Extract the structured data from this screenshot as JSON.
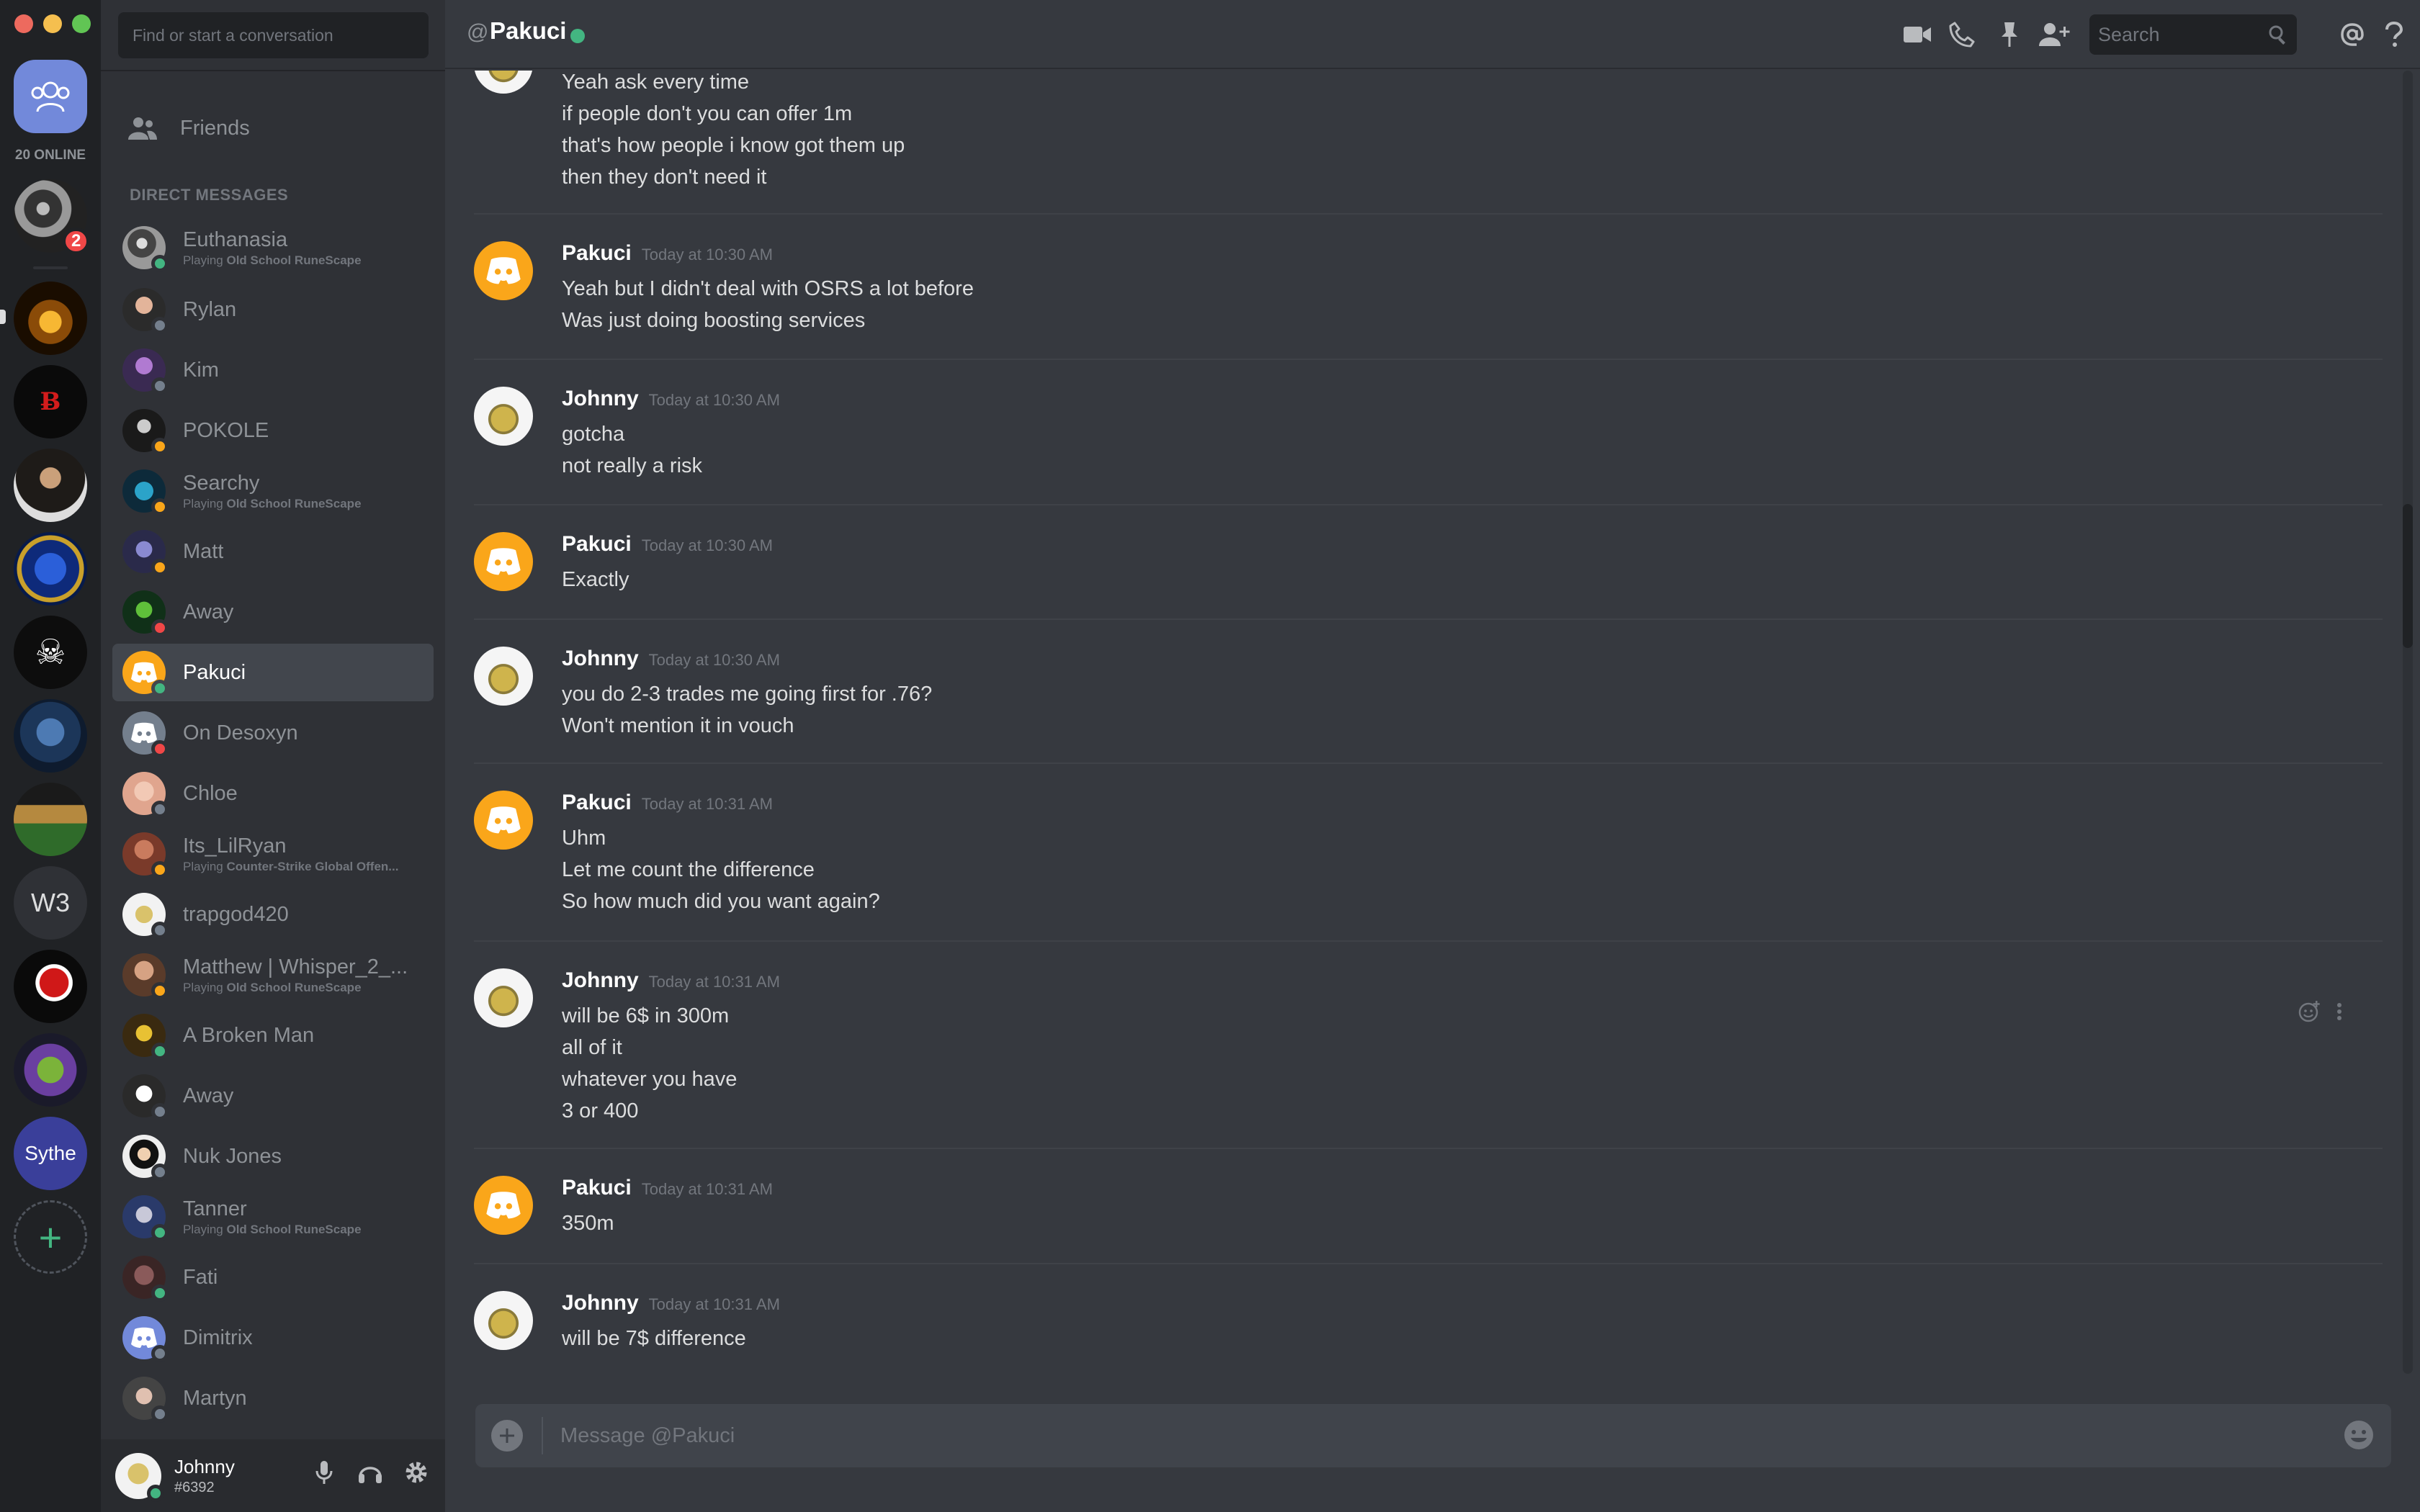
{
  "window": {
    "controls": [
      "close",
      "minimize",
      "maximize"
    ]
  },
  "servers": {
    "online_label": "20 ONLINE",
    "badge_count": "2",
    "w3_label": "W3",
    "add_label": "+"
  },
  "dm_sidebar": {
    "search_placeholder": "Find or start a conversation",
    "friends_label": "Friends",
    "section_header": "DIRECT MESSAGES",
    "items": [
      {
        "name": "Euthanasia",
        "status": "online",
        "activity_prefix": "Playing ",
        "activity_game": "Old School RuneScape"
      },
      {
        "name": "Rylan",
        "status": "offline"
      },
      {
        "name": "Kim",
        "status": "offline"
      },
      {
        "name": "POKOLE",
        "status": "idle"
      },
      {
        "name": "Searchy",
        "status": "idle",
        "activity_prefix": "Playing ",
        "activity_game": "Old School RuneScape"
      },
      {
        "name": "Matt",
        "status": "idle"
      },
      {
        "name": "Away",
        "status": "dnd"
      },
      {
        "name": "Pakuci",
        "status": "online",
        "active": true
      },
      {
        "name": "On Desoxyn",
        "status": "dnd"
      },
      {
        "name": "Chloe",
        "status": "offline"
      },
      {
        "name": "Its_LilRyan",
        "status": "idle",
        "activity_prefix": "Playing ",
        "activity_game": "Counter-Strike Global Offen..."
      },
      {
        "name": "trapgod420",
        "status": "offline"
      },
      {
        "name": "Matthew | Whisper_2_...",
        "status": "idle",
        "activity_prefix": "Playing ",
        "activity_game": "Old School RuneScape"
      },
      {
        "name": "A Broken Man",
        "status": "online"
      },
      {
        "name": "Away",
        "status": "offline"
      },
      {
        "name": "Nuk Jones",
        "status": "offline"
      },
      {
        "name": "Tanner",
        "status": "online",
        "activity_prefix": "Playing ",
        "activity_game": "Old School RuneScape"
      },
      {
        "name": "Fati",
        "status": "online"
      },
      {
        "name": "Dimitrix",
        "status": "offline"
      },
      {
        "name": "Martyn",
        "status": "offline"
      }
    ]
  },
  "user_panel": {
    "name": "Johnny",
    "tag": "#6392"
  },
  "topbar": {
    "at_symbol": "@",
    "channel_name": "Pakuci",
    "search_placeholder": "Search",
    "icons": [
      "video-call-icon",
      "voice-call-icon",
      "pin-icon",
      "add-friend-icon",
      "search-icon",
      "mention-icon",
      "help-icon"
    ]
  },
  "messages": [
    {
      "author": "",
      "time": "",
      "lines": [
        "Yeah ask every time",
        "if people don't you can offer 1m",
        "that's how people i know got them up",
        "then they don't need it"
      ]
    },
    {
      "author": "Pakuci",
      "time": "Today at 10:30 AM",
      "lines": [
        "Yeah but I didn't deal with OSRS a lot before",
        "Was just doing boosting services"
      ]
    },
    {
      "author": "Johnny",
      "time": "Today at 10:30 AM",
      "lines": [
        "gotcha",
        "not really a risk"
      ]
    },
    {
      "author": "Pakuci",
      "time": "Today at 10:30 AM",
      "lines": [
        "Exactly"
      ]
    },
    {
      "author": "Johnny",
      "time": "Today at 10:30 AM",
      "lines": [
        "you do 2-3 trades me going first for .76?",
        "Won't mention it in vouch"
      ]
    },
    {
      "author": "Pakuci",
      "time": "Today at 10:31 AM",
      "lines": [
        "Uhm",
        "Let me count the difference",
        "So how much did you want again?"
      ]
    },
    {
      "author": "Johnny",
      "time": "Today at 10:31 AM",
      "lines": [
        "will be 6$ in 300m",
        "all of it",
        "whatever you have",
        "3 or 400"
      ]
    },
    {
      "author": "Pakuci",
      "time": "Today at 10:31 AM",
      "lines": [
        "350m"
      ]
    },
    {
      "author": "Johnny",
      "time": "Today at 10:31 AM",
      "lines": [
        "will be 7$ difference"
      ]
    }
  ],
  "composer": {
    "placeholder": "Message @Pakuci"
  },
  "colors": {
    "online": "#43b581",
    "idle": "#faa61a",
    "dnd": "#f04747",
    "offline": "#747f8d",
    "blurple": "#7289da"
  }
}
